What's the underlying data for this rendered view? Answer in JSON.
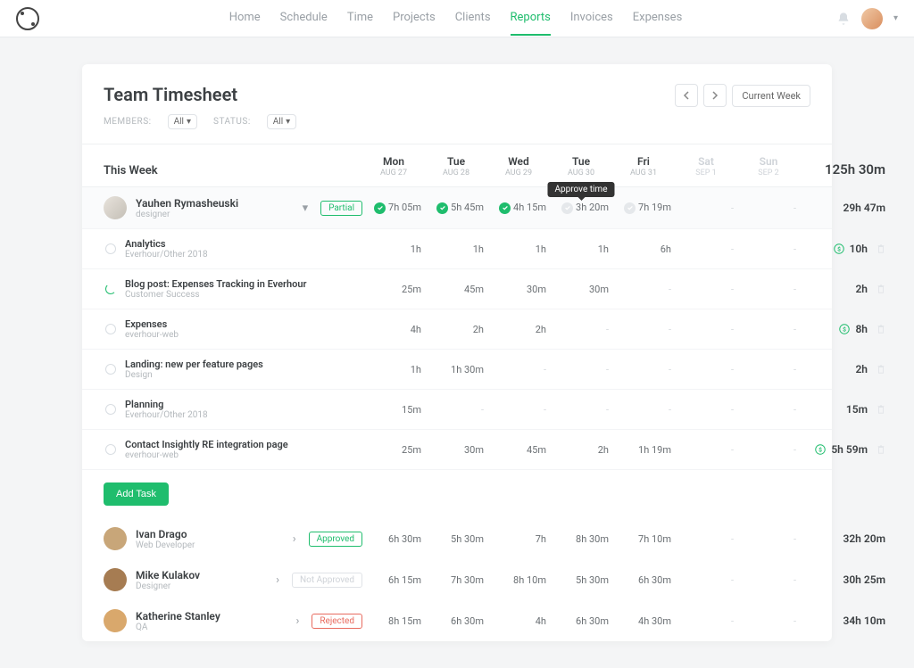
{
  "nav": {
    "items": [
      "Home",
      "Schedule",
      "Time",
      "Projects",
      "Clients",
      "Reports",
      "Invoices",
      "Expenses"
    ],
    "active_index": 5
  },
  "page": {
    "title": "Team Timesheet",
    "members_label": "MEMBERS:",
    "members_value": "All",
    "status_label": "STATUS:",
    "status_value": "All",
    "current_week_btn": "Current Week",
    "week_heading": "This Week",
    "total_week": "125h 30m",
    "add_task": "Add Task",
    "tooltip": "Approve time"
  },
  "days": [
    {
      "name": "Mon",
      "date": "AUG 27",
      "weekend": false
    },
    {
      "name": "Tue",
      "date": "AUG 28",
      "weekend": false
    },
    {
      "name": "Wed",
      "date": "AUG 29",
      "weekend": false
    },
    {
      "name": "Tue",
      "date": "AUG 30",
      "weekend": false
    },
    {
      "name": "Fri",
      "date": "AUG 31",
      "weekend": false
    },
    {
      "name": "Sat",
      "date": "SEP 1",
      "weekend": true
    },
    {
      "name": "Sun",
      "date": "SEP 2",
      "weekend": true
    }
  ],
  "primary_user": {
    "name": "Yauhen Rymasheuski",
    "role": "designer",
    "badge": "Partial",
    "times": [
      {
        "val": "7h 05m",
        "status": "done"
      },
      {
        "val": "5h 45m",
        "status": "done"
      },
      {
        "val": "4h 15m",
        "status": "done"
      },
      {
        "val": "3h 20m",
        "status": "pending",
        "tooltip": true
      },
      {
        "val": "7h 19m",
        "status": "pending"
      },
      {
        "val": "-",
        "status": "dim"
      },
      {
        "val": "-",
        "status": "dim"
      }
    ],
    "total": "29h 47m"
  },
  "tasks": [
    {
      "name": "Analytics",
      "sub": "Everhour/Other 2018",
      "cells": [
        "1h",
        "1h",
        "1h",
        "1h",
        "6h",
        "-",
        "-"
      ],
      "total": "10h",
      "money": true
    },
    {
      "name": "Blog post: Expenses Tracking in Everhour",
      "sub": "Customer Success",
      "cells": [
        "25m",
        "45m",
        "30m",
        "30m",
        "-",
        "-",
        "-"
      ],
      "total": "2h",
      "active": true
    },
    {
      "name": "Expenses",
      "sub": "everhour-web",
      "cells": [
        "4h",
        "2h",
        "2h",
        "-",
        "-",
        "-",
        "-"
      ],
      "total": "8h",
      "money": true
    },
    {
      "name": "Landing: new per feature pages",
      "sub": "Design",
      "cells": [
        "1h",
        "1h 30m",
        "-",
        "-",
        "-",
        "-",
        "-"
      ],
      "total": "2h"
    },
    {
      "name": "Planning",
      "sub": "Everhour/Other 2018",
      "cells": [
        "15m",
        "-",
        "-",
        "-",
        "-",
        "-",
        "-"
      ],
      "total": "15m"
    },
    {
      "name": "Contact Insightly RE integration page",
      "sub": "everhour-web",
      "cells": [
        "25m",
        "30m",
        "45m",
        "2h",
        "1h 19m",
        "-",
        "-"
      ],
      "total": "5h 59m",
      "money": true
    }
  ],
  "other_users": [
    {
      "name": "Ivan Drago",
      "role": "Web Developer",
      "badge": "Approved",
      "badge_class": "approved",
      "cells": [
        "6h 30m",
        "5h 30m",
        "7h",
        "8h 30m",
        "7h 10m",
        "-",
        "-"
      ],
      "total": "32h 20m",
      "avatar": "#c8a679"
    },
    {
      "name": "Mike Kulakov",
      "role": "Designer",
      "badge": "Not Approved",
      "badge_class": "not-approved",
      "cells": [
        "6h 15m",
        "7h 30m",
        "8h 10m",
        "5h 30m",
        "6h 30m",
        "-",
        "-"
      ],
      "total": "30h 25m",
      "avatar": "#a67c52"
    },
    {
      "name": "Katherine Stanley",
      "role": "QA",
      "badge": "Rejected",
      "badge_class": "rejected",
      "cells": [
        "8h 15m",
        "6h 30m",
        "4h",
        "6h 30m",
        "4h 30m",
        "-",
        "-"
      ],
      "total": "34h 10m",
      "avatar": "#d9a86c"
    }
  ]
}
